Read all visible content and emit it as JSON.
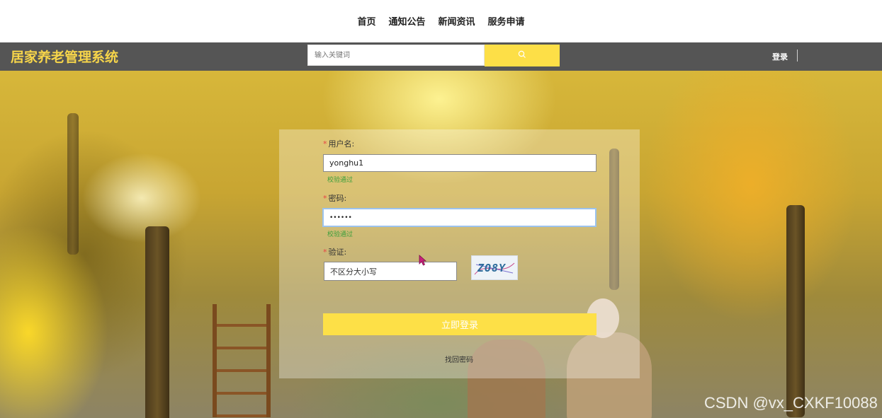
{
  "top_nav": {
    "items": [
      "首页",
      "通知公告",
      "新闻资讯",
      "服务申请"
    ]
  },
  "header": {
    "brand": "居家养老管理系统",
    "search": {
      "placeholder": "输入关键词",
      "icon": "search-icon"
    },
    "login_link": "登录"
  },
  "login_form": {
    "username": {
      "label": "用户名:",
      "value": "yonghu1",
      "hint": "校验通过"
    },
    "password": {
      "label": "密码:",
      "value": "••••••",
      "hint": "校验通过"
    },
    "captcha": {
      "label": "验证:",
      "placeholder": "不区分大小写",
      "image_text": "ZO8Y"
    },
    "submit_label": "立即登录",
    "forgot_label": "找回密码"
  },
  "watermark": "CSDN @vx_CXKF10088",
  "colors": {
    "accent_yellow": "#fde047",
    "header_bg": "#555555",
    "brand_text": "#f7d54a",
    "valid_green": "#3c9f3c",
    "required_red": "#e84545"
  }
}
